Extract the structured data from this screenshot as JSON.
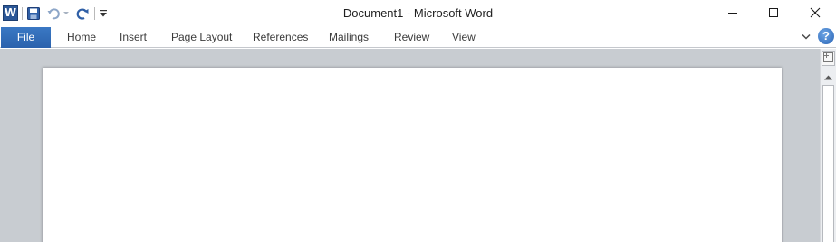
{
  "app": {
    "title": "Document1  -  Microsoft Word",
    "icon_letter": "W"
  },
  "quick_access": {
    "save_icon": "save-icon",
    "undo_icon": "undo-icon",
    "redo_icon": "redo-icon",
    "customize_icon": "customize-qat-icon"
  },
  "window_controls": {
    "minimize": "minimize-icon",
    "maximize": "maximize-icon",
    "close": "close-icon"
  },
  "ribbon": {
    "file_tab": "File",
    "tabs": [
      "Home",
      "Insert",
      "Page Layout",
      "References",
      "Mailings",
      "Review",
      "View"
    ],
    "minimize_icon": "chevron-down-icon",
    "help_label": "?"
  },
  "colors": {
    "file_tab": "#2b62ad",
    "word_blue": "#2b5797",
    "workspace": "#c8ccd1",
    "page": "#ffffff"
  }
}
